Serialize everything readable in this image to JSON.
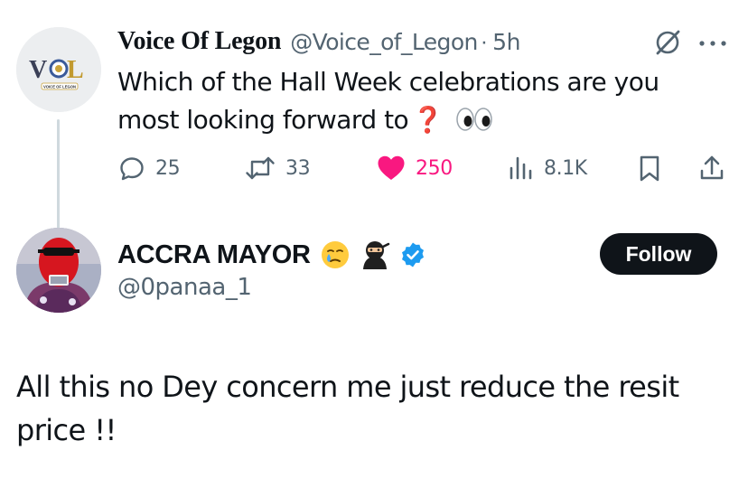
{
  "parent_tweet": {
    "author_name": "Voice Of Legon",
    "handle": "@Voice_of_Legon",
    "separator": "·",
    "time": "5h",
    "avatar_logo_text": "VOL",
    "avatar_caption": "VOICE OF LEGON",
    "text": "Which of the Hall Week celebrations are you most looking forward to",
    "text_emojis": [
      "red-question-mark",
      "eyes"
    ],
    "question_mark": "❓",
    "replies": "25",
    "reposts": "33",
    "likes": "250",
    "views": "8.1K",
    "liked": true,
    "like_color": "#f91880"
  },
  "reply": {
    "author_name": "ACCRA MAYOR",
    "name_emojis": [
      "crying-face",
      "ninja"
    ],
    "verified": true,
    "verified_color": "#1d9bf0",
    "handle": "@0panaa_1",
    "follow_label": "Follow",
    "text": "All this no Dey concern me just reduce the resit price !!"
  },
  "colors": {
    "text": "#0f1419",
    "secondary": "#536471",
    "thread_line": "#cfd9de",
    "follow_bg": "#0f1419"
  },
  "icons": [
    "grok-icon",
    "more-icon",
    "reply-icon",
    "repost-icon",
    "like-icon",
    "views-icon",
    "bookmark-icon",
    "share-icon"
  ]
}
